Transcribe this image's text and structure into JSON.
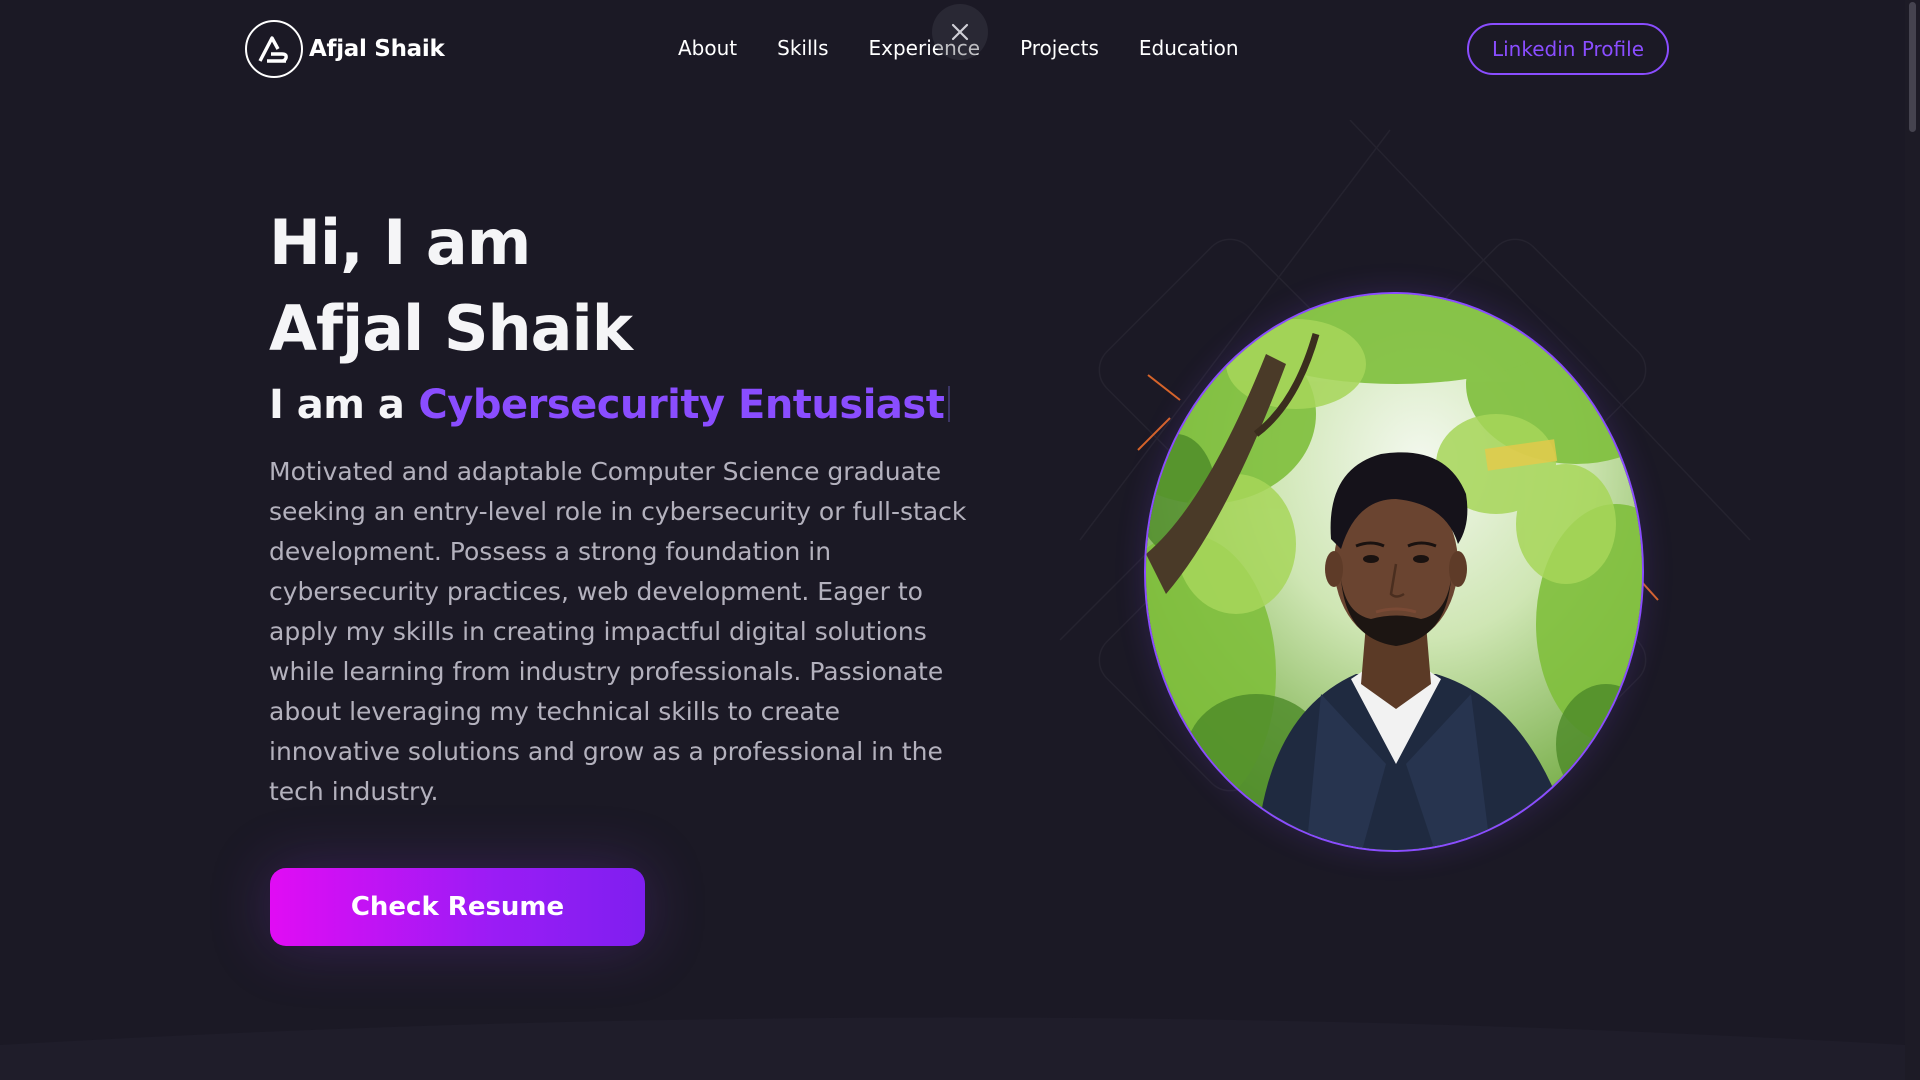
{
  "brand": {
    "name": "Afjal Shaik",
    "logo_icon": "brand-logo-icon"
  },
  "nav": {
    "links": [
      {
        "label": "About"
      },
      {
        "label": "Skills"
      },
      {
        "label": "Experience"
      },
      {
        "label": "Projects"
      },
      {
        "label": "Education"
      }
    ],
    "linkedin_label": "Linkedin Profile",
    "close_icon": "close-icon"
  },
  "hero": {
    "greeting": "Hi, I am",
    "name": "Afjal Shaik",
    "role_prefix": "I am a",
    "role_typed": "Cybersecurity Entusiast",
    "description": "Motivated and adaptable Computer Science graduate seeking an entry-level role in cybersecurity or full-stack development. Possess a strong foundation in cybersecurity practices, web development. Eager to apply my skills in creating impactful digital solutions while learning from industry professionals. Passionate about leveraging my technical skills to create innovative solutions and grow as a professional in the tech industry.",
    "resume_button": "Check Resume"
  },
  "colors": {
    "background": "#1b1925",
    "accent": "#8a4dff",
    "button_gradient_start": "#e10cf4",
    "button_gradient_end": "#7f1ff0",
    "text_muted": "#b3b1bd"
  }
}
